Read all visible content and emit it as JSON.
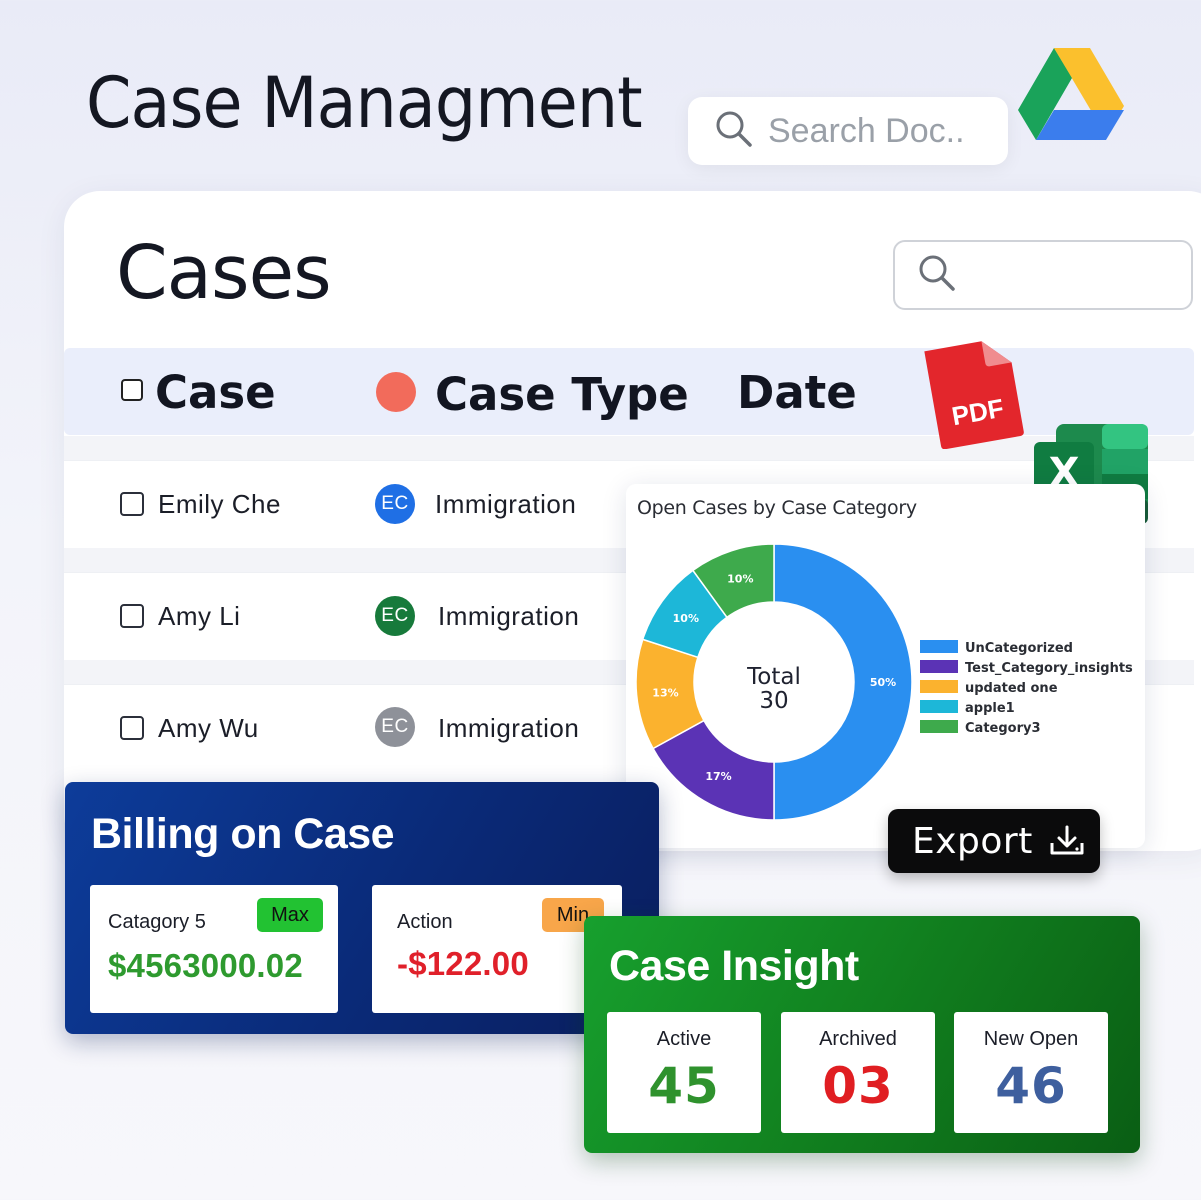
{
  "header": {
    "title": "Case Managment",
    "search_placeholder": "Search Doc..",
    "drive_icon": "google-drive-icon"
  },
  "cases": {
    "title": "Cases",
    "columns": {
      "case": "Case",
      "case_type": "Case Type",
      "date": "Date"
    },
    "rows": [
      {
        "name": "Emily Che",
        "initials": "EC",
        "avatar_color": "#1f6fe5",
        "type": "Immigration"
      },
      {
        "name": "Amy Li",
        "initials": "EC",
        "avatar_color": "#177a3b",
        "type": "Immigration"
      },
      {
        "name": "Amy Wu",
        "initials": "EC",
        "avatar_color": "#8e9199",
        "type": "Immigration"
      }
    ]
  },
  "file_icons": {
    "pdf_label": "PDF",
    "excel_label": "X"
  },
  "chart": {
    "title": "Open Cases by Case Category",
    "export_label": "Export"
  },
  "chart_data": {
    "type": "pie",
    "variant": "donut",
    "center_label": "Total",
    "center_value": "30",
    "categories": [
      "UnCategorized",
      "Test_Category_insights",
      "updated one",
      "apple1",
      "Category3"
    ],
    "values": [
      50,
      17,
      13,
      10,
      10
    ],
    "value_labels": [
      "50%",
      "17%",
      "13%",
      "10%",
      "10%"
    ],
    "colors": [
      "#2a8ff0",
      "#5b33b5",
      "#fbb22e",
      "#1db7d8",
      "#3eaa4c"
    ],
    "legend_position": "right"
  },
  "billing": {
    "title": "Billing on Case",
    "items": [
      {
        "label": "Catagory 5",
        "value": "$4563000.02",
        "tag": "Max",
        "tag_color": "#22c232",
        "value_color": "#2e9a2f"
      },
      {
        "label": "Action",
        "value": "-$122.00",
        "tag": "Min",
        "tag_color": "#f8a64a",
        "value_color": "#e0202a"
      }
    ]
  },
  "insight": {
    "title": "Case Insight",
    "items": [
      {
        "label": "Active",
        "value": "45",
        "color": "#2f922d"
      },
      {
        "label": "Archived",
        "value": "03",
        "color": "#e01e22"
      },
      {
        "label": "New Open",
        "value": "46",
        "color": "#3e5f9e"
      }
    ]
  }
}
